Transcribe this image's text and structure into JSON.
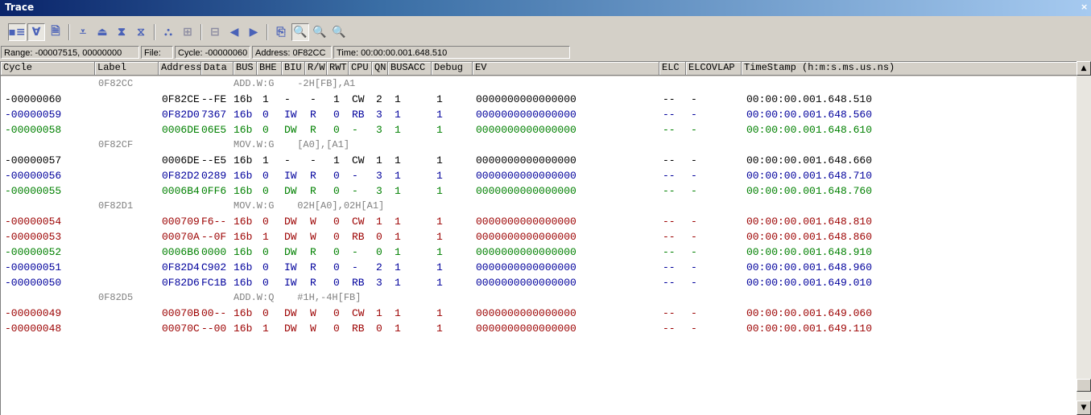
{
  "window": {
    "title": "Trace",
    "close_glyph": "×"
  },
  "toolbar": [
    {
      "icon": "trace-mode-icon",
      "glyph": "▪≡",
      "pressed": true
    },
    {
      "icon": "filter-icon",
      "glyph": "∀",
      "pressed": true
    },
    {
      "icon": "document-icon",
      "glyph": "🗎"
    },
    {
      "sep": true
    },
    {
      "icon": "scroll-down-icon",
      "glyph": "⩡"
    },
    {
      "icon": "scroll-up-icon",
      "glyph": "⏏"
    },
    {
      "icon": "expand-icon",
      "glyph": "⧗"
    },
    {
      "icon": "collapse-icon",
      "glyph": "⧖"
    },
    {
      "sep": true
    },
    {
      "icon": "source-link-icon",
      "glyph": "⛬"
    },
    {
      "icon": "split-view-icon",
      "glyph": "⊞",
      "dim": true
    },
    {
      "sep": true
    },
    {
      "icon": "window-icon",
      "glyph": "⊟",
      "dim": true
    },
    {
      "icon": "step-back-icon",
      "glyph": "◀"
    },
    {
      "icon": "step-forward-icon",
      "glyph": "▶"
    },
    {
      "sep": true
    },
    {
      "icon": "settings-window-icon",
      "glyph": "⎘"
    },
    {
      "icon": "find-icon",
      "glyph": "🔍",
      "pressed": true
    },
    {
      "icon": "find-prev-icon",
      "glyph": "🔍"
    },
    {
      "icon": "find-next-icon",
      "glyph": "🔍"
    }
  ],
  "status": {
    "range": "Range: -00007515, 00000000",
    "file": "File:",
    "cycle": "Cycle: -00000060",
    "address": "Address: 0F82CC",
    "time": "Time: 00:00:00.001.648.510"
  },
  "columns": [
    "Cycle",
    "Label",
    "Address",
    "Data",
    "BUS",
    "BHE",
    "BIU",
    "R/W",
    "RWT",
    "CPU",
    "QN",
    "BUSACC",
    "Debug",
    "EV",
    "ELC",
    "ELCOVLAP",
    "TimeStamp (h:m:s.ms.us.ns)"
  ],
  "colors": {
    "black": "#000000",
    "blue": "#00009c",
    "green": "#008000",
    "red": "#9c0000",
    "source": "#808080"
  },
  "rows": [
    {
      "type": "src",
      "addr": "0F82CC",
      "text": "ADD.W:G    -2H[FB],A1"
    },
    {
      "color": "black",
      "cycle": "-00000060",
      "address": "0F82CE",
      "data": "--FE",
      "bus": "16b",
      "bhe": "1",
      "biu": "-",
      "rw": "-",
      "rwt": "1",
      "cpu": "CW",
      "qn": "2",
      "busacc": "1",
      "debug": "1",
      "ev": "0000000000000000",
      "elc": "--",
      "elcovlap": "-",
      "ts": "00:00:00.001.648.510"
    },
    {
      "color": "blue",
      "cycle": "-00000059",
      "address": "0F82D0",
      "data": "7367",
      "bus": "16b",
      "bhe": "0",
      "biu": "IW",
      "rw": "R",
      "rwt": "0",
      "cpu": "RB",
      "qn": "3",
      "busacc": "1",
      "debug": "1",
      "ev": "0000000000000000",
      "elc": "--",
      "elcovlap": "-",
      "ts": "00:00:00.001.648.560"
    },
    {
      "color": "green",
      "cycle": "-00000058",
      "address": "0006DE",
      "data": "06E5",
      "bus": "16b",
      "bhe": "0",
      "biu": "DW",
      "rw": "R",
      "rwt": "0",
      "cpu": "-",
      "qn": "3",
      "busacc": "1",
      "debug": "1",
      "ev": "0000000000000000",
      "elc": "--",
      "elcovlap": "-",
      "ts": "00:00:00.001.648.610"
    },
    {
      "type": "src",
      "addr": "0F82CF",
      "text": "MOV.W:G    [A0],[A1]"
    },
    {
      "color": "black",
      "cycle": "-00000057",
      "address": "0006DE",
      "data": "--E5",
      "bus": "16b",
      "bhe": "1",
      "biu": "-",
      "rw": "-",
      "rwt": "1",
      "cpu": "CW",
      "qn": "1",
      "busacc": "1",
      "debug": "1",
      "ev": "0000000000000000",
      "elc": "--",
      "elcovlap": "-",
      "ts": "00:00:00.001.648.660"
    },
    {
      "color": "blue",
      "cycle": "-00000056",
      "address": "0F82D2",
      "data": "0289",
      "bus": "16b",
      "bhe": "0",
      "biu": "IW",
      "rw": "R",
      "rwt": "0",
      "cpu": "-",
      "qn": "3",
      "busacc": "1",
      "debug": "1",
      "ev": "0000000000000000",
      "elc": "--",
      "elcovlap": "-",
      "ts": "00:00:00.001.648.710"
    },
    {
      "color": "green",
      "cycle": "-00000055",
      "address": "0006B4",
      "data": "0FF6",
      "bus": "16b",
      "bhe": "0",
      "biu": "DW",
      "rw": "R",
      "rwt": "0",
      "cpu": "-",
      "qn": "3",
      "busacc": "1",
      "debug": "1",
      "ev": "0000000000000000",
      "elc": "--",
      "elcovlap": "-",
      "ts": "00:00:00.001.648.760"
    },
    {
      "type": "src",
      "addr": "0F82D1",
      "text": "MOV.W:G    02H[A0],02H[A1]"
    },
    {
      "color": "red",
      "cycle": "-00000054",
      "address": "000709",
      "data": "F6--",
      "bus": "16b",
      "bhe": "0",
      "biu": "DW",
      "rw": "W",
      "rwt": "0",
      "cpu": "CW",
      "qn": "1",
      "busacc": "1",
      "debug": "1",
      "ev": "0000000000000000",
      "elc": "--",
      "elcovlap": "-",
      "ts": "00:00:00.001.648.810"
    },
    {
      "color": "red",
      "cycle": "-00000053",
      "address": "00070A",
      "data": "--0F",
      "bus": "16b",
      "bhe": "1",
      "biu": "DW",
      "rw": "W",
      "rwt": "0",
      "cpu": "RB",
      "qn": "0",
      "busacc": "1",
      "debug": "1",
      "ev": "0000000000000000",
      "elc": "--",
      "elcovlap": "-",
      "ts": "00:00:00.001.648.860"
    },
    {
      "color": "green",
      "cycle": "-00000052",
      "address": "0006B6",
      "data": "0000",
      "bus": "16b",
      "bhe": "0",
      "biu": "DW",
      "rw": "R",
      "rwt": "0",
      "cpu": "-",
      "qn": "0",
      "busacc": "1",
      "debug": "1",
      "ev": "0000000000000000",
      "elc": "--",
      "elcovlap": "-",
      "ts": "00:00:00.001.648.910"
    },
    {
      "color": "blue",
      "cycle": "-00000051",
      "address": "0F82D4",
      "data": "C902",
      "bus": "16b",
      "bhe": "0",
      "biu": "IW",
      "rw": "R",
      "rwt": "0",
      "cpu": "-",
      "qn": "2",
      "busacc": "1",
      "debug": "1",
      "ev": "0000000000000000",
      "elc": "--",
      "elcovlap": "-",
      "ts": "00:00:00.001.648.960"
    },
    {
      "color": "blue",
      "cycle": "-00000050",
      "address": "0F82D6",
      "data": "FC1B",
      "bus": "16b",
      "bhe": "0",
      "biu": "IW",
      "rw": "R",
      "rwt": "0",
      "cpu": "RB",
      "qn": "3",
      "busacc": "1",
      "debug": "1",
      "ev": "0000000000000000",
      "elc": "--",
      "elcovlap": "-",
      "ts": "00:00:00.001.649.010"
    },
    {
      "type": "src",
      "addr": "0F82D5",
      "text": "ADD.W:Q    #1H,-4H[FB]"
    },
    {
      "color": "red",
      "cycle": "-00000049",
      "address": "00070B",
      "data": "00--",
      "bus": "16b",
      "bhe": "0",
      "biu": "DW",
      "rw": "W",
      "rwt": "0",
      "cpu": "CW",
      "qn": "1",
      "busacc": "1",
      "debug": "1",
      "ev": "0000000000000000",
      "elc": "--",
      "elcovlap": "-",
      "ts": "00:00:00.001.649.060"
    },
    {
      "color": "red",
      "cycle": "-00000048",
      "address": "00070C",
      "data": "--00",
      "bus": "16b",
      "bhe": "1",
      "biu": "DW",
      "rw": "W",
      "rwt": "0",
      "cpu": "RB",
      "qn": "0",
      "busacc": "1",
      "debug": "1",
      "ev": "0000000000000000",
      "elc": "--",
      "elcovlap": "-",
      "ts": "00:00:00.001.649.110"
    }
  ],
  "scrollbar": {
    "up": "▲",
    "down": "▼"
  }
}
